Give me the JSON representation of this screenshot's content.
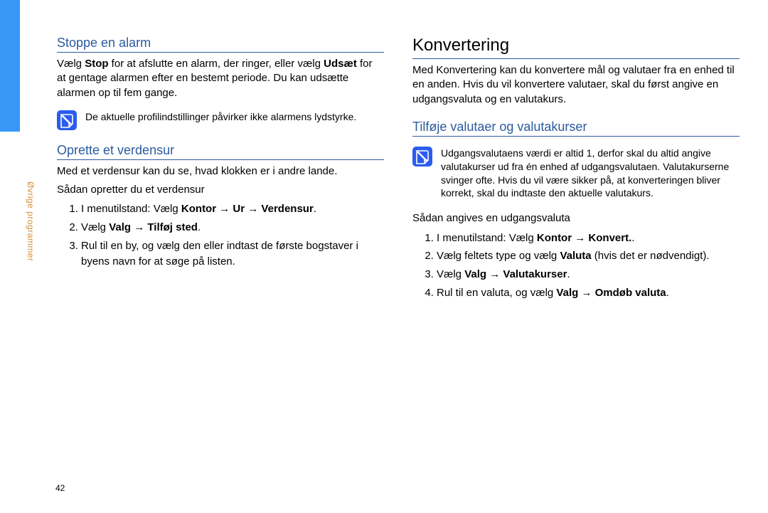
{
  "sidebar": {
    "label": "Øvrige programmer"
  },
  "page_number": "42",
  "left": {
    "h2a": "Stoppe en alarm",
    "p1_pre": "Vælg ",
    "p1_b1": "Stop",
    "p1_mid": " for at afslutte en alarm, der ringer, eller vælg ",
    "p1_b2": "Udsæt",
    "p1_post": " for at gentage alarmen efter en bestemt periode. Du kan udsætte alarmen op til fem gange.",
    "note1": "De aktuelle profilindstillinger påvirker ikke alarmens lydstyrke.",
    "h2b": "Oprette et verdensur",
    "p2": "Med et verdensur kan du se, hvad klokken er i andre lande.",
    "p3": "Sådan opretter du et verdensur",
    "li1_pre": "I menutilstand: Vælg ",
    "li1_b1": "Kontor",
    "li1_mid1": " → ",
    "li1_b2": "Ur",
    "li1_mid2": " → ",
    "li1_b3": "Verdensur",
    "li1_post": ".",
    "li2_pre": "Vælg ",
    "li2_b1": "Valg",
    "li2_mid": " → ",
    "li2_b2": "Tilføj sted",
    "li2_post": ".",
    "li3": "Rul til en by, og vælg den eller indtast de første bogstaver i byens navn for at søge på listen."
  },
  "right": {
    "h1": "Konvertering",
    "p1": "Med Konvertering kan du konvertere mål og valutaer fra en enhed til en anden. Hvis du vil konvertere valutaer, skal du først angive en udgangsvaluta og en valutakurs.",
    "h2a": "Tilføje valutaer og valutakurser",
    "note1": "Udgangsvalutaens værdi er altid 1, derfor skal du altid angive valutakurser ud fra én enhed af udgangsvalutaen. Valutakurserne svinger ofte. Hvis du vil være sikker på, at konverteringen bliver korrekt, skal du indtaste den aktuelle valutakurs.",
    "p2": "Sådan angives en udgangsvaluta",
    "li1_pre": "I menutilstand: Vælg ",
    "li1_b1": "Kontor",
    "li1_mid": " → ",
    "li1_b2": "Konvert.",
    "li1_post": ".",
    "li2_pre": "Vælg feltets type og vælg ",
    "li2_b1": "Valuta",
    "li2_post": " (hvis det er nødvendigt).",
    "li3_pre": "Vælg ",
    "li3_b1": "Valg",
    "li3_mid": " → ",
    "li3_b2": "Valutakurser",
    "li3_post": ".",
    "li4_pre": "Rul til en valuta, og vælg ",
    "li4_b1": "Valg",
    "li4_mid": " → ",
    "li4_b2": "Omdøb valuta",
    "li4_post": "."
  }
}
